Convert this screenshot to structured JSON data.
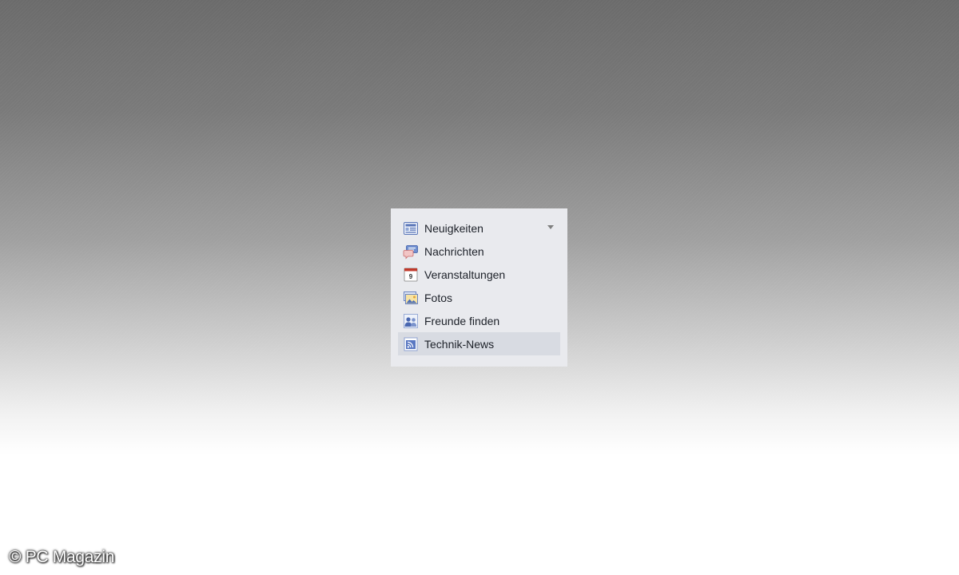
{
  "menu": {
    "items": [
      {
        "label": "Neuigkeiten",
        "icon": "news-feed-icon",
        "has_dropdown": true,
        "selected": false
      },
      {
        "label": "Nachrichten",
        "icon": "messages-icon",
        "selected": false
      },
      {
        "label": "Veranstaltungen",
        "icon": "calendar-icon",
        "calendar_day": "9",
        "selected": false
      },
      {
        "label": "Fotos",
        "icon": "photos-icon",
        "selected": false
      },
      {
        "label": "Freunde finden",
        "icon": "find-friends-icon",
        "selected": false
      },
      {
        "label": "Technik-News",
        "icon": "rss-feed-icon",
        "selected": true
      }
    ]
  },
  "watermark": "© PC Magazin",
  "colors": {
    "panel_bg": "#e9eaee",
    "selected_bg": "#d8dbe2",
    "text": "#1d2129",
    "icon_blue": "#4a67b0",
    "calendar_red": "#c0392b"
  }
}
